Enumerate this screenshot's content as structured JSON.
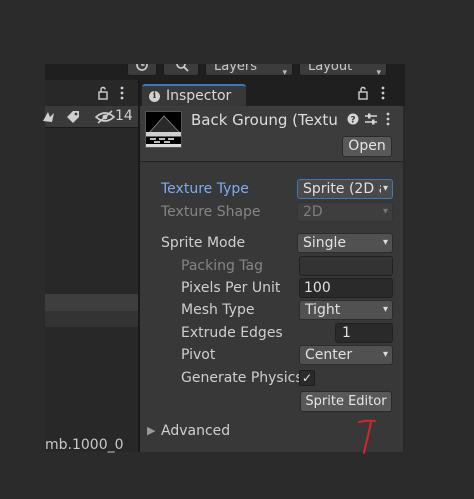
{
  "toolbar": {
    "history_icon": "history-icon",
    "search_icon": "search-icon",
    "layers_label": "Layers",
    "layout_label": "Layout"
  },
  "left_panel": {
    "tag_icon": "tag-icon",
    "visibility_count": "14",
    "item_text": "mb.1000_0"
  },
  "inspector": {
    "tab_label": "Inspector",
    "asset_title": "Back Groung (Texture",
    "open_label": "Open",
    "fields": {
      "texture_type_label": "Texture Type",
      "texture_type_value": "Sprite (2D a",
      "texture_shape_label": "Texture Shape",
      "texture_shape_value": "2D",
      "sprite_mode_label": "Sprite Mode",
      "sprite_mode_value": "Single",
      "packing_tag_label": "Packing Tag",
      "packing_tag_value": "",
      "pixels_per_unit_label": "Pixels Per Unit",
      "pixels_per_unit_value": "100",
      "mesh_type_label": "Mesh Type",
      "mesh_type_value": "Tight",
      "extrude_edges_label": "Extrude Edges",
      "extrude_edges_value": "1",
      "pivot_label": "Pivot",
      "pivot_value": "Center",
      "generate_physics_label": "Generate Physics",
      "generate_physics_checked": true
    },
    "sprite_editor_label": "Sprite Editor",
    "advanced_label": "Advanced"
  },
  "colors": {
    "accent_blue": "#7aaef0",
    "tab_highlight": "#3a79bb",
    "annotation_red": "#d3262a"
  }
}
